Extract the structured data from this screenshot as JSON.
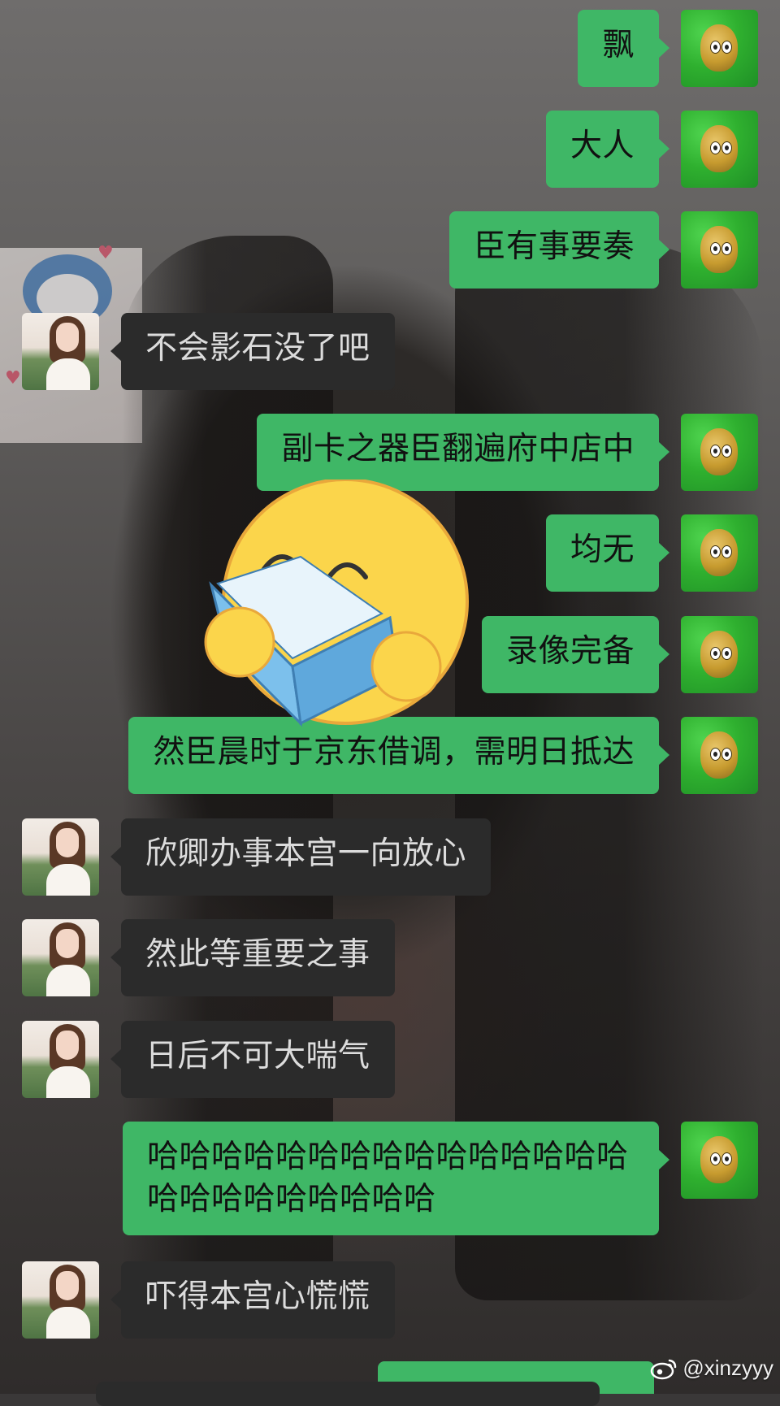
{
  "conversation": {
    "messages": [
      {
        "side": "right",
        "text": "飘"
      },
      {
        "side": "right",
        "text": "大人"
      },
      {
        "side": "right",
        "text": "臣有事要奏"
      },
      {
        "side": "left",
        "text": "不会影石没了吧"
      },
      {
        "side": "right",
        "text": "副卡之器臣翻遍府中店中"
      },
      {
        "side": "right",
        "text": "均无"
      },
      {
        "side": "right",
        "text": "录像完备"
      },
      {
        "side": "right",
        "text": "然臣晨时于京东借调，需明日抵达"
      },
      {
        "side": "left",
        "text": "欣卿办事本宫一向放心"
      },
      {
        "side": "left",
        "text": "然此等重要之事"
      },
      {
        "side": "left",
        "text": "日后不可大喘气"
      },
      {
        "side": "right",
        "text": "哈哈哈哈哈哈哈哈哈哈哈哈哈哈哈\n哈哈哈哈哈哈哈哈哈"
      },
      {
        "side": "left",
        "text": "吓得本宫心慌慌"
      }
    ]
  },
  "sticker": {
    "name": "reading-book-smiley-sticker"
  },
  "avatars": {
    "me": "wall-nut-avatar",
    "them": "girl-avatar"
  },
  "watermark": {
    "text": "@xinzyyy"
  },
  "colors": {
    "my_bubble": "#3fb766",
    "their_bubble": "#2b2b2b"
  }
}
